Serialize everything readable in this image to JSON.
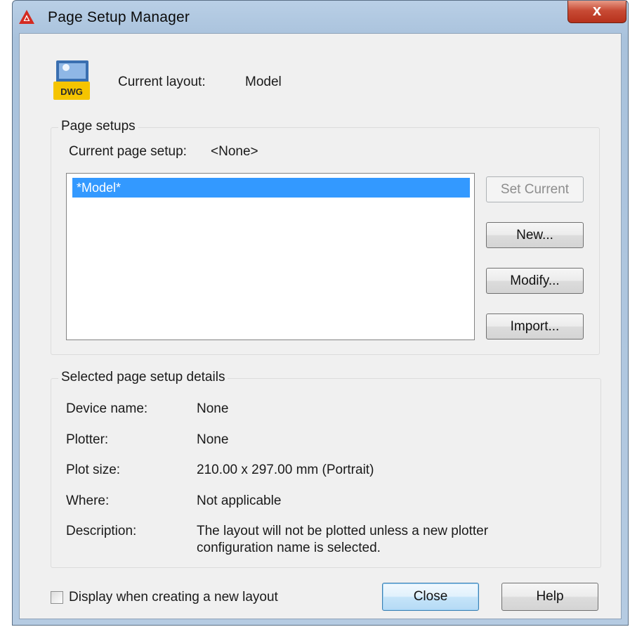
{
  "window": {
    "title": "Page Setup Manager",
    "close_glyph": "x"
  },
  "icons": {
    "app": "autocad-logo-icon",
    "file": "dwg-file-icon",
    "file_label": "DWG",
    "close": "close-icon"
  },
  "current_layout": {
    "label": "Current layout:",
    "value": "Model"
  },
  "page_setups": {
    "group_title": "Page setups",
    "current_label": "Current page setup:",
    "current_value": "<None>",
    "items": [
      {
        "label": "*Model*",
        "selected": true
      }
    ],
    "buttons": {
      "set_current": "Set Current",
      "new": "New...",
      "modify": "Modify...",
      "import": "Import..."
    }
  },
  "details": {
    "group_title": "Selected page setup details",
    "device_name": {
      "label": "Device name:",
      "value": "None"
    },
    "plotter": {
      "label": "Plotter:",
      "value": "None"
    },
    "plot_size": {
      "label": "Plot size:",
      "value": "210.00 x 297.00 mm (Portrait)"
    },
    "where": {
      "label": "Where:",
      "value": "Not applicable"
    },
    "description": {
      "label": "Description:",
      "line1": "The layout will not be plotted unless a new plotter",
      "line2": "configuration name is selected."
    }
  },
  "footer": {
    "checkbox_label": "Display when creating a new layout",
    "checkbox_checked": false,
    "close": "Close",
    "help": "Help"
  },
  "colors": {
    "selection": "#3399ff",
    "brand_red": "#d42a20",
    "dwg_yellow": "#f5c400"
  }
}
